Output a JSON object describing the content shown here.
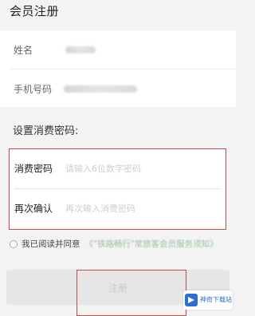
{
  "header": {
    "title": "会员注册"
  },
  "basic": {
    "name_label": "姓名",
    "phone_label": "手机号码"
  },
  "password_section": {
    "title": "设置消费密码:",
    "password_label": "消费密码",
    "password_placeholder": "请输入6位数字密码",
    "confirm_label": "再次确认",
    "confirm_placeholder": "再次输入消费密码"
  },
  "agreement": {
    "text": "我已阅读并同意",
    "link": "《\"铁路畅行\"常旅客会员服务须知》"
  },
  "submit": {
    "label": "注册"
  },
  "watermark": {
    "text": "神奇下载站"
  },
  "colors": {
    "highlight": "#c94a4a",
    "watermark": "#2a6ed6"
  }
}
